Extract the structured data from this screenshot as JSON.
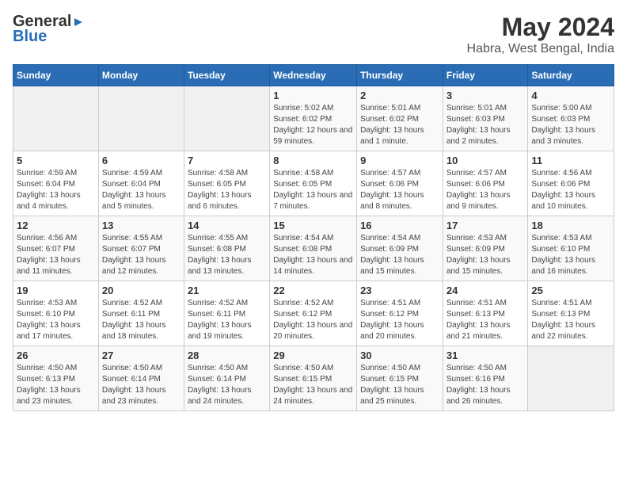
{
  "logo": {
    "general": "General",
    "blue": "Blue"
  },
  "title": "May 2024",
  "subtitle": "Habra, West Bengal, India",
  "headers": [
    "Sunday",
    "Monday",
    "Tuesday",
    "Wednesday",
    "Thursday",
    "Friday",
    "Saturday"
  ],
  "weeks": [
    [
      {
        "day": "",
        "info": ""
      },
      {
        "day": "",
        "info": ""
      },
      {
        "day": "",
        "info": ""
      },
      {
        "day": "1",
        "info": "Sunrise: 5:02 AM\nSunset: 6:02 PM\nDaylight: 12 hours and 59 minutes."
      },
      {
        "day": "2",
        "info": "Sunrise: 5:01 AM\nSunset: 6:02 PM\nDaylight: 13 hours and 1 minute."
      },
      {
        "day": "3",
        "info": "Sunrise: 5:01 AM\nSunset: 6:03 PM\nDaylight: 13 hours and 2 minutes."
      },
      {
        "day": "4",
        "info": "Sunrise: 5:00 AM\nSunset: 6:03 PM\nDaylight: 13 hours and 3 minutes."
      }
    ],
    [
      {
        "day": "5",
        "info": "Sunrise: 4:59 AM\nSunset: 6:04 PM\nDaylight: 13 hours and 4 minutes."
      },
      {
        "day": "6",
        "info": "Sunrise: 4:59 AM\nSunset: 6:04 PM\nDaylight: 13 hours and 5 minutes."
      },
      {
        "day": "7",
        "info": "Sunrise: 4:58 AM\nSunset: 6:05 PM\nDaylight: 13 hours and 6 minutes."
      },
      {
        "day": "8",
        "info": "Sunrise: 4:58 AM\nSunset: 6:05 PM\nDaylight: 13 hours and 7 minutes."
      },
      {
        "day": "9",
        "info": "Sunrise: 4:57 AM\nSunset: 6:06 PM\nDaylight: 13 hours and 8 minutes."
      },
      {
        "day": "10",
        "info": "Sunrise: 4:57 AM\nSunset: 6:06 PM\nDaylight: 13 hours and 9 minutes."
      },
      {
        "day": "11",
        "info": "Sunrise: 4:56 AM\nSunset: 6:06 PM\nDaylight: 13 hours and 10 minutes."
      }
    ],
    [
      {
        "day": "12",
        "info": "Sunrise: 4:56 AM\nSunset: 6:07 PM\nDaylight: 13 hours and 11 minutes."
      },
      {
        "day": "13",
        "info": "Sunrise: 4:55 AM\nSunset: 6:07 PM\nDaylight: 13 hours and 12 minutes."
      },
      {
        "day": "14",
        "info": "Sunrise: 4:55 AM\nSunset: 6:08 PM\nDaylight: 13 hours and 13 minutes."
      },
      {
        "day": "15",
        "info": "Sunrise: 4:54 AM\nSunset: 6:08 PM\nDaylight: 13 hours and 14 minutes."
      },
      {
        "day": "16",
        "info": "Sunrise: 4:54 AM\nSunset: 6:09 PM\nDaylight: 13 hours and 15 minutes."
      },
      {
        "day": "17",
        "info": "Sunrise: 4:53 AM\nSunset: 6:09 PM\nDaylight: 13 hours and 15 minutes."
      },
      {
        "day": "18",
        "info": "Sunrise: 4:53 AM\nSunset: 6:10 PM\nDaylight: 13 hours and 16 minutes."
      }
    ],
    [
      {
        "day": "19",
        "info": "Sunrise: 4:53 AM\nSunset: 6:10 PM\nDaylight: 13 hours and 17 minutes."
      },
      {
        "day": "20",
        "info": "Sunrise: 4:52 AM\nSunset: 6:11 PM\nDaylight: 13 hours and 18 minutes."
      },
      {
        "day": "21",
        "info": "Sunrise: 4:52 AM\nSunset: 6:11 PM\nDaylight: 13 hours and 19 minutes."
      },
      {
        "day": "22",
        "info": "Sunrise: 4:52 AM\nSunset: 6:12 PM\nDaylight: 13 hours and 20 minutes."
      },
      {
        "day": "23",
        "info": "Sunrise: 4:51 AM\nSunset: 6:12 PM\nDaylight: 13 hours and 20 minutes."
      },
      {
        "day": "24",
        "info": "Sunrise: 4:51 AM\nSunset: 6:13 PM\nDaylight: 13 hours and 21 minutes."
      },
      {
        "day": "25",
        "info": "Sunrise: 4:51 AM\nSunset: 6:13 PM\nDaylight: 13 hours and 22 minutes."
      }
    ],
    [
      {
        "day": "26",
        "info": "Sunrise: 4:50 AM\nSunset: 6:13 PM\nDaylight: 13 hours and 23 minutes."
      },
      {
        "day": "27",
        "info": "Sunrise: 4:50 AM\nSunset: 6:14 PM\nDaylight: 13 hours and 23 minutes."
      },
      {
        "day": "28",
        "info": "Sunrise: 4:50 AM\nSunset: 6:14 PM\nDaylight: 13 hours and 24 minutes."
      },
      {
        "day": "29",
        "info": "Sunrise: 4:50 AM\nSunset: 6:15 PM\nDaylight: 13 hours and 24 minutes."
      },
      {
        "day": "30",
        "info": "Sunrise: 4:50 AM\nSunset: 6:15 PM\nDaylight: 13 hours and 25 minutes."
      },
      {
        "day": "31",
        "info": "Sunrise: 4:50 AM\nSunset: 6:16 PM\nDaylight: 13 hours and 26 minutes."
      },
      {
        "day": "",
        "info": ""
      }
    ]
  ]
}
